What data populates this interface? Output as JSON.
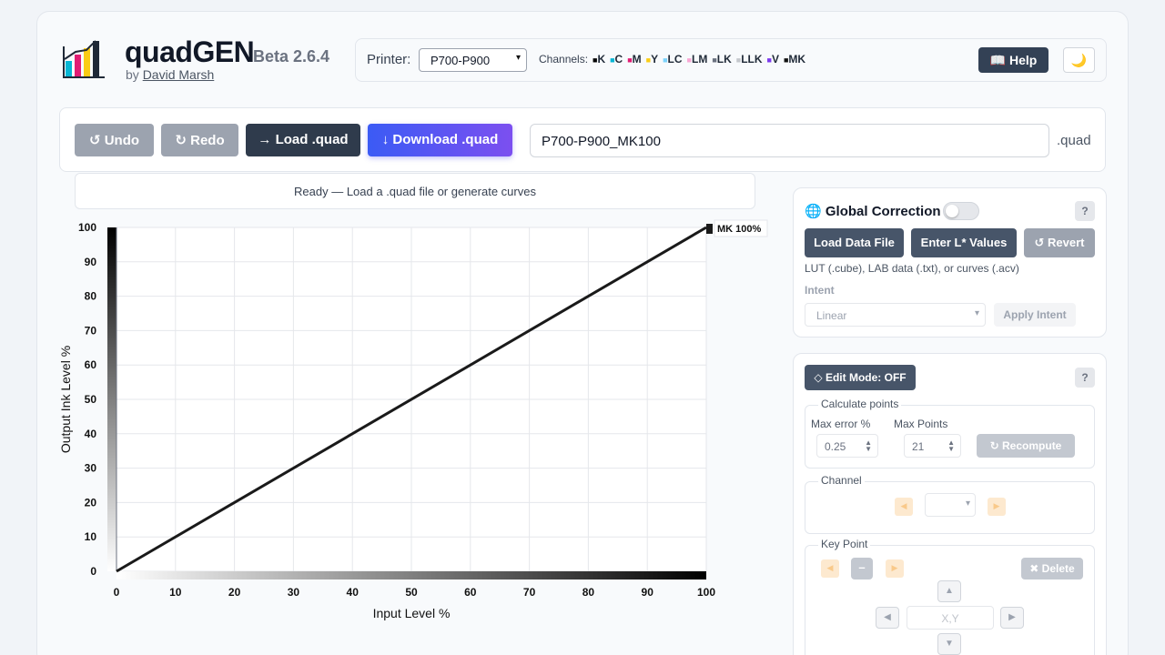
{
  "header": {
    "title": "quadGEN",
    "version": "Beta 2.6.4",
    "by": "by",
    "author": "David Marsh"
  },
  "printer": {
    "label": "Printer:",
    "selected": "P700-P900",
    "channels_label": "Channels:",
    "channels": [
      {
        "name": "K",
        "color": "#000000"
      },
      {
        "name": "C",
        "color": "#06b6d4"
      },
      {
        "name": "M",
        "color": "#e11d74"
      },
      {
        "name": "Y",
        "color": "#facc15"
      },
      {
        "name": "LC",
        "color": "#7dd3fc"
      },
      {
        "name": "LM",
        "color": "#f9a8d4"
      },
      {
        "name": "LK",
        "color": "#6b7280"
      },
      {
        "name": "LLK",
        "color": "#c4c7cc"
      },
      {
        "name": "V",
        "color": "#7c3aed"
      },
      {
        "name": "MK",
        "color": "#111111"
      }
    ],
    "help_label": "📖 Help",
    "theme_icon": "moon-icon"
  },
  "toolbar": {
    "undo": "↺ Undo",
    "redo": "↻ Redo",
    "load": "→ Load .quad",
    "download": "↓ Download .quad",
    "filename": "P700-P900_MK100",
    "ext": ".quad"
  },
  "status": "Ready — Load a .quad file or generate curves",
  "chart_data": {
    "type": "line",
    "x_ticks": [
      0,
      10,
      20,
      30,
      40,
      50,
      60,
      70,
      80,
      90,
      100
    ],
    "y_ticks": [
      0,
      10,
      20,
      30,
      40,
      50,
      60,
      70,
      80,
      90,
      100
    ],
    "xlim": [
      0,
      100
    ],
    "ylim": [
      0,
      100
    ],
    "xlabel": "Input Level %",
    "ylabel": "Output Ink Level %",
    "grid": true,
    "series": [
      {
        "name": "MK 100%",
        "color": "#1a1a1a",
        "x": [
          0,
          100
        ],
        "y": [
          0,
          100
        ]
      }
    ]
  },
  "global_correction": {
    "title": "Global Correction",
    "icon": "globe-icon",
    "help": "?",
    "load_data": "Load Data File",
    "enter_l": "Enter L* Values",
    "revert": "↺ Revert",
    "hint": "LUT (.cube), LAB data (.txt), or curves (.acv)",
    "intent_label": "Intent",
    "intent_value": "Linear",
    "apply_intent": "Apply Intent"
  },
  "edit_mode": {
    "button": "◇ Edit Mode: OFF",
    "help": "?",
    "calc_legend": "Calculate points",
    "max_error_label": "Max error %",
    "max_error_value": "0.25",
    "max_points_label": "Max Points",
    "max_points_value": "21",
    "recompute": "↻ Recompute",
    "channel_legend": "Channel",
    "keypoint_legend": "Key Point",
    "minus": "–",
    "delete": "✖ Delete",
    "xy_placeholder": "X,Y"
  }
}
